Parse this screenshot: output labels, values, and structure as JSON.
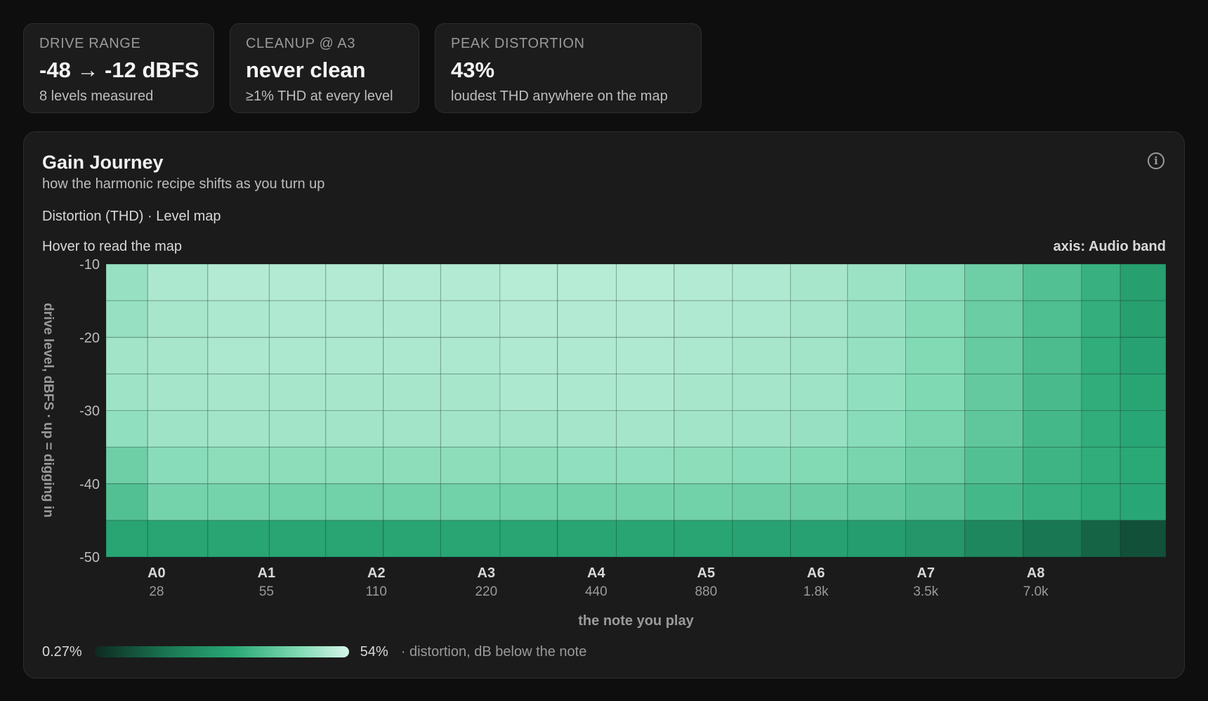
{
  "stats": [
    {
      "label": "DRIVE RANGE",
      "value": "-48 → -12 dBFS",
      "sub": "8 levels measured"
    },
    {
      "label": "CLEANUP @ A3",
      "value": "never clean",
      "sub": "≥1% THD at every level"
    },
    {
      "label": "PEAK DISTORTION",
      "value": "43%",
      "sub": "loudest THD anywhere on the map"
    }
  ],
  "panel": {
    "title": "Gain Journey",
    "subtitle": "how the harmonic recipe shifts as you turn up",
    "mode": "Distortion (THD) · Level map",
    "hint": "Hover to read the map",
    "axis_name": "axis: Audio band",
    "info_icon": "info-icon"
  },
  "legend": {
    "min": "0.27%",
    "max": "54%",
    "caption": "· distortion, dB below the note"
  },
  "chart_data": {
    "type": "heatmap",
    "title": "Gain Journey",
    "xlabel": "the note you play",
    "ylabel": "drive level, dBFS · up = digging in",
    "y_ticks": [
      "-10",
      "-20",
      "-30",
      "-40",
      "-50"
    ],
    "ylim": [
      -50,
      -10
    ],
    "x_ticks": [
      {
        "note": "A0",
        "freq": "28"
      },
      {
        "note": "A1",
        "freq": "55"
      },
      {
        "note": "A2",
        "freq": "110"
      },
      {
        "note": "A3",
        "freq": "220"
      },
      {
        "note": "A4",
        "freq": "440"
      },
      {
        "note": "A5",
        "freq": "880"
      },
      {
        "note": "A6",
        "freq": "1.8k"
      },
      {
        "note": "A7",
        "freq": "3.5k"
      },
      {
        "note": "A8",
        "freq": "7.0k"
      }
    ],
    "x_range_hz": [
      20,
      16000
    ],
    "column_edges_hz": [
      20,
      26,
      38,
      56,
      80,
      115,
      165,
      240,
      345,
      500,
      720,
      1040,
      1500,
      2150,
      3100,
      4500,
      6500,
      9400,
      12000,
      16000
    ],
    "y_levels_dbfs": [
      -12,
      -17,
      -22,
      -27,
      -32,
      -38,
      -43,
      -48
    ],
    "scale_min": 0.27,
    "scale_max": 54,
    "color_stops": [
      "#0d2a20",
      "#1a7a55",
      "#2aa876",
      "#7fd9b3",
      "#d5f5e8"
    ],
    "z": [
      [
        0.82,
        0.88,
        0.9,
        0.9,
        0.9,
        0.9,
        0.9,
        0.91,
        0.91,
        0.91,
        0.9,
        0.89,
        0.87,
        0.83,
        0.78,
        0.7,
        0.62,
        0.54,
        0.45,
        0.3
      ],
      [
        0.82,
        0.87,
        0.88,
        0.89,
        0.89,
        0.89,
        0.89,
        0.9,
        0.9,
        0.9,
        0.89,
        0.88,
        0.86,
        0.82,
        0.77,
        0.69,
        0.61,
        0.53,
        0.45,
        0.35
      ],
      [
        0.85,
        0.87,
        0.88,
        0.88,
        0.88,
        0.88,
        0.88,
        0.89,
        0.89,
        0.89,
        0.88,
        0.87,
        0.85,
        0.81,
        0.76,
        0.68,
        0.6,
        0.52,
        0.46,
        0.42
      ],
      [
        0.84,
        0.86,
        0.87,
        0.87,
        0.87,
        0.87,
        0.87,
        0.88,
        0.88,
        0.88,
        0.87,
        0.86,
        0.84,
        0.8,
        0.75,
        0.67,
        0.59,
        0.52,
        0.48,
        0.46
      ],
      [
        0.8,
        0.84,
        0.85,
        0.85,
        0.85,
        0.85,
        0.85,
        0.85,
        0.86,
        0.86,
        0.85,
        0.84,
        0.82,
        0.78,
        0.73,
        0.66,
        0.58,
        0.52,
        0.49,
        0.47
      ],
      [
        0.7,
        0.78,
        0.79,
        0.79,
        0.79,
        0.79,
        0.79,
        0.79,
        0.8,
        0.8,
        0.79,
        0.78,
        0.76,
        0.73,
        0.69,
        0.62,
        0.56,
        0.52,
        0.5,
        0.45
      ],
      [
        0.62,
        0.72,
        0.72,
        0.71,
        0.71,
        0.71,
        0.71,
        0.71,
        0.71,
        0.71,
        0.71,
        0.7,
        0.69,
        0.67,
        0.64,
        0.58,
        0.54,
        0.51,
        0.49,
        0.28
      ],
      [
        0.48,
        0.48,
        0.48,
        0.48,
        0.48,
        0.48,
        0.48,
        0.48,
        0.48,
        0.48,
        0.48,
        0.47,
        0.46,
        0.44,
        0.4,
        0.32,
        0.24,
        0.18,
        0.12,
        0.04
      ]
    ]
  }
}
